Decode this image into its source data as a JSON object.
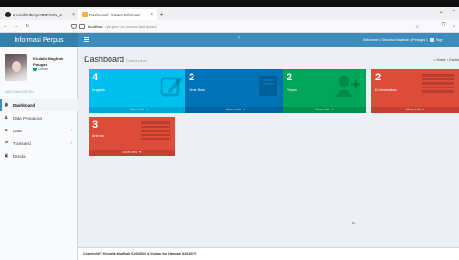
{
  "browser": {
    "tabs": [
      {
        "title": "Khulaifah/ProjectPROYEK_K",
        "active": false
      },
      {
        "title": "Dashboard | Sistem Informasi",
        "active": true
      }
    ],
    "url_host": "localhost",
    "url_path": "/perpus-ci3-master/dashboard"
  },
  "app": {
    "logo": "Informasi Perpus",
    "welcome": "Welcome !, Khulaila Magfirah ( Petugas )",
    "signout": "Sign"
  },
  "sidebar": {
    "user_name": "Khulaila Magfirah Petugas",
    "status": "Online",
    "nav_header": "MAIN NAVIGATION",
    "items": [
      {
        "label": "Dashboard",
        "icon": "dashboard-icon",
        "active": true
      },
      {
        "label": "Data Pengguna",
        "icon": "user-icon",
        "active": false
      },
      {
        "label": "Data",
        "icon": "book-icon",
        "active": false,
        "submenu": true
      },
      {
        "label": "Transaksi",
        "icon": "exchange-icon",
        "active": false,
        "submenu": true
      },
      {
        "label": "Denda",
        "icon": "money-icon",
        "active": false
      }
    ]
  },
  "content": {
    "title": "Dashboard",
    "subtitle": "Control panel",
    "breadcrumb_home": "Home",
    "breadcrumb_current": "Dashb",
    "boxes": [
      {
        "number": "4",
        "label": "Anggota",
        "more": "More info",
        "color": "#00c0ef",
        "icon": "edit-icon"
      },
      {
        "number": "2",
        "label": "Jenis Buku",
        "more": "More info",
        "color": "#0073b7",
        "icon": "book-icon"
      },
      {
        "number": "2",
        "label": "Pinjam",
        "more": "More info",
        "color": "#00a65a",
        "icon": "user-plus-icon"
      },
      {
        "number": "2",
        "label": "Di Kembalikan",
        "more": "More info",
        "color": "#dd4b39",
        "icon": "list-icon"
      },
      {
        "number": "3",
        "label": "Antrean",
        "more": "More info",
        "color": "#dd4b39",
        "icon": "list-icon"
      }
    ]
  },
  "footer": {
    "copyright": "Copyright © Khulaila Magfirah (1204003) & Ilhulan Nur Hamzah (1204007)"
  }
}
